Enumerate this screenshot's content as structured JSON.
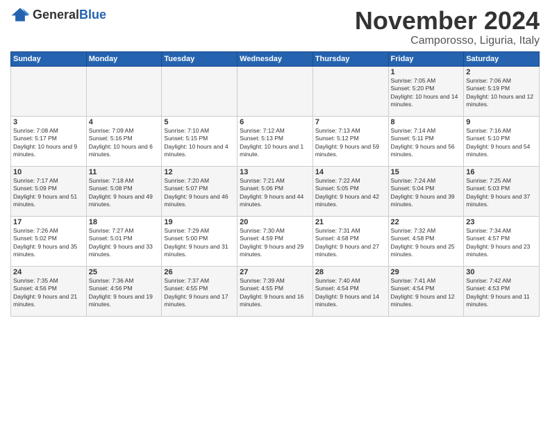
{
  "header": {
    "logo_general": "General",
    "logo_blue": "Blue",
    "month_title": "November 2024",
    "location": "Camporosso, Liguria, Italy"
  },
  "weekdays": [
    "Sunday",
    "Monday",
    "Tuesday",
    "Wednesday",
    "Thursday",
    "Friday",
    "Saturday"
  ],
  "weeks": [
    [
      {
        "day": "",
        "info": ""
      },
      {
        "day": "",
        "info": ""
      },
      {
        "day": "",
        "info": ""
      },
      {
        "day": "",
        "info": ""
      },
      {
        "day": "",
        "info": ""
      },
      {
        "day": "1",
        "info": "Sunrise: 7:05 AM\nSunset: 5:20 PM\nDaylight: 10 hours and 14 minutes."
      },
      {
        "day": "2",
        "info": "Sunrise: 7:06 AM\nSunset: 5:19 PM\nDaylight: 10 hours and 12 minutes."
      }
    ],
    [
      {
        "day": "3",
        "info": "Sunrise: 7:08 AM\nSunset: 5:17 PM\nDaylight: 10 hours and 9 minutes."
      },
      {
        "day": "4",
        "info": "Sunrise: 7:09 AM\nSunset: 5:16 PM\nDaylight: 10 hours and 6 minutes."
      },
      {
        "day": "5",
        "info": "Sunrise: 7:10 AM\nSunset: 5:15 PM\nDaylight: 10 hours and 4 minutes."
      },
      {
        "day": "6",
        "info": "Sunrise: 7:12 AM\nSunset: 5:13 PM\nDaylight: 10 hours and 1 minute."
      },
      {
        "day": "7",
        "info": "Sunrise: 7:13 AM\nSunset: 5:12 PM\nDaylight: 9 hours and 59 minutes."
      },
      {
        "day": "8",
        "info": "Sunrise: 7:14 AM\nSunset: 5:11 PM\nDaylight: 9 hours and 56 minutes."
      },
      {
        "day": "9",
        "info": "Sunrise: 7:16 AM\nSunset: 5:10 PM\nDaylight: 9 hours and 54 minutes."
      }
    ],
    [
      {
        "day": "10",
        "info": "Sunrise: 7:17 AM\nSunset: 5:09 PM\nDaylight: 9 hours and 51 minutes."
      },
      {
        "day": "11",
        "info": "Sunrise: 7:18 AM\nSunset: 5:08 PM\nDaylight: 9 hours and 49 minutes."
      },
      {
        "day": "12",
        "info": "Sunrise: 7:20 AM\nSunset: 5:07 PM\nDaylight: 9 hours and 46 minutes."
      },
      {
        "day": "13",
        "info": "Sunrise: 7:21 AM\nSunset: 5:06 PM\nDaylight: 9 hours and 44 minutes."
      },
      {
        "day": "14",
        "info": "Sunrise: 7:22 AM\nSunset: 5:05 PM\nDaylight: 9 hours and 42 minutes."
      },
      {
        "day": "15",
        "info": "Sunrise: 7:24 AM\nSunset: 5:04 PM\nDaylight: 9 hours and 39 minutes."
      },
      {
        "day": "16",
        "info": "Sunrise: 7:25 AM\nSunset: 5:03 PM\nDaylight: 9 hours and 37 minutes."
      }
    ],
    [
      {
        "day": "17",
        "info": "Sunrise: 7:26 AM\nSunset: 5:02 PM\nDaylight: 9 hours and 35 minutes."
      },
      {
        "day": "18",
        "info": "Sunrise: 7:27 AM\nSunset: 5:01 PM\nDaylight: 9 hours and 33 minutes."
      },
      {
        "day": "19",
        "info": "Sunrise: 7:29 AM\nSunset: 5:00 PM\nDaylight: 9 hours and 31 minutes."
      },
      {
        "day": "20",
        "info": "Sunrise: 7:30 AM\nSunset: 4:59 PM\nDaylight: 9 hours and 29 minutes."
      },
      {
        "day": "21",
        "info": "Sunrise: 7:31 AM\nSunset: 4:58 PM\nDaylight: 9 hours and 27 minutes."
      },
      {
        "day": "22",
        "info": "Sunrise: 7:32 AM\nSunset: 4:58 PM\nDaylight: 9 hours and 25 minutes."
      },
      {
        "day": "23",
        "info": "Sunrise: 7:34 AM\nSunset: 4:57 PM\nDaylight: 9 hours and 23 minutes."
      }
    ],
    [
      {
        "day": "24",
        "info": "Sunrise: 7:35 AM\nSunset: 4:56 PM\nDaylight: 9 hours and 21 minutes."
      },
      {
        "day": "25",
        "info": "Sunrise: 7:36 AM\nSunset: 4:56 PM\nDaylight: 9 hours and 19 minutes."
      },
      {
        "day": "26",
        "info": "Sunrise: 7:37 AM\nSunset: 4:55 PM\nDaylight: 9 hours and 17 minutes."
      },
      {
        "day": "27",
        "info": "Sunrise: 7:39 AM\nSunset: 4:55 PM\nDaylight: 9 hours and 16 minutes."
      },
      {
        "day": "28",
        "info": "Sunrise: 7:40 AM\nSunset: 4:54 PM\nDaylight: 9 hours and 14 minutes."
      },
      {
        "day": "29",
        "info": "Sunrise: 7:41 AM\nSunset: 4:54 PM\nDaylight: 9 hours and 12 minutes."
      },
      {
        "day": "30",
        "info": "Sunrise: 7:42 AM\nSunset: 4:53 PM\nDaylight: 9 hours and 11 minutes."
      }
    ]
  ]
}
